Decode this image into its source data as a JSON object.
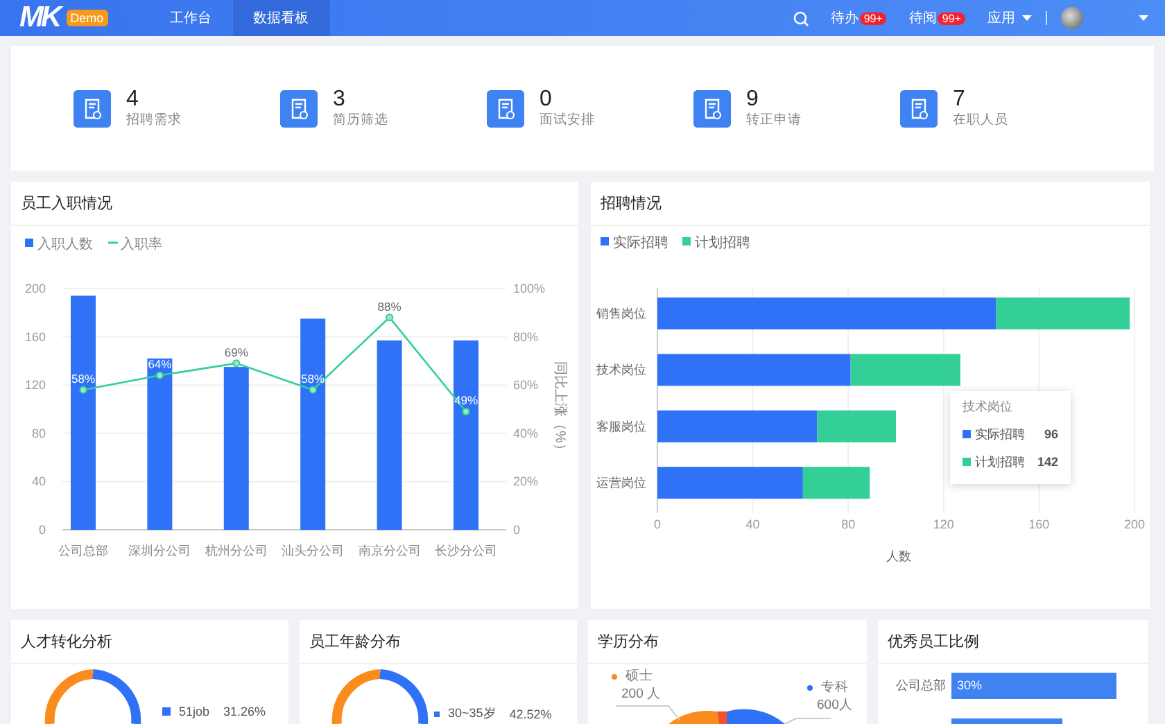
{
  "header": {
    "logo": "MK",
    "badge": "Demo",
    "nav": [
      {
        "label": "工作台",
        "selected": false
      },
      {
        "label": "数据看板",
        "selected": true
      }
    ],
    "notices": [
      {
        "label": "待办",
        "badge": "99+"
      },
      {
        "label": "待阅",
        "badge": "99+"
      }
    ],
    "apps": "应用"
  },
  "stats": [
    {
      "value": "4",
      "label": "招聘需求"
    },
    {
      "value": "3",
      "label": "简历筛选"
    },
    {
      "value": "0",
      "label": "面试安排"
    },
    {
      "value": "9",
      "label": "转正申请"
    },
    {
      "value": "7",
      "label": "在职人员"
    }
  ],
  "onboarding": {
    "title": "员工入职情况",
    "chart_data": {
      "type": "bar",
      "categories": [
        "公司总部",
        "深圳分公司",
        "杭州分公司",
        "汕头分公司",
        "南京分公司",
        "长沙分公司"
      ],
      "legend": true,
      "grid": true,
      "series": [
        {
          "name": "入职人数",
          "type": "bar",
          "color": "#2f72f7",
          "values": [
            194,
            142,
            135,
            175,
            157,
            157
          ]
        },
        {
          "name": "入职率",
          "type": "line",
          "axis": "y2",
          "marker": "circle",
          "color": "#33cf97",
          "values": [
            58,
            64,
            69,
            58,
            88,
            49
          ],
          "value_labels": [
            "58%",
            "64%",
            "69%",
            "58%",
            "88%",
            "49%"
          ]
        }
      ],
      "y2label": "同比上涨（%）",
      "ylim": [
        0,
        200
      ],
      "yticks": [
        0,
        40,
        80,
        120,
        160,
        200
      ],
      "y2lim": [
        0,
        100
      ],
      "y2ticks": [
        {
          "value": 0,
          "label": "0"
        },
        {
          "value": 20,
          "label": "20%"
        },
        {
          "value": 40,
          "label": "40%"
        },
        {
          "value": 60,
          "label": "60%"
        },
        {
          "value": 80,
          "label": "80%"
        },
        {
          "value": 100,
          "label": "100%"
        }
      ]
    }
  },
  "recruitment": {
    "title": "招聘情况",
    "chart_data": {
      "type": "bar",
      "orientation": "horizontal",
      "stacked": true,
      "categories": [
        "销售岗位",
        "技术岗位",
        "客服岗位",
        "运营岗位"
      ],
      "series": [
        {
          "name": "实际招聘",
          "color": "#2f72f7",
          "values": [
            142,
            81,
            67,
            61
          ]
        },
        {
          "name": "计划招聘",
          "color": "#33cf97",
          "values": [
            56,
            46,
            33,
            28
          ]
        }
      ],
      "legend": true,
      "grid": true,
      "xlabel": "人数",
      "xlim": [
        0,
        200
      ],
      "xticks": [
        0,
        40,
        80,
        120,
        160,
        200
      ]
    },
    "tooltip": {
      "title": "技术岗位",
      "items": [
        {
          "label": "实际招聘",
          "value": "96",
          "color": "#2f72f7"
        },
        {
          "label": "计划招聘",
          "value": "142",
          "color": "#33cf97"
        }
      ]
    }
  },
  "conversion": {
    "title": "人才转化分析",
    "legend": [
      {
        "label": "51job",
        "value": "31.26%",
        "color": "#2f72f7"
      }
    ]
  },
  "age": {
    "title": "员工年龄分布",
    "legend": [
      {
        "label": "30~35岁",
        "value": "42.52%",
        "color": "#2f72f7"
      }
    ]
  },
  "education": {
    "title": "学历分布",
    "labels": [
      {
        "label": "硕士",
        "value": "200 人",
        "color": "#fa8c1e"
      },
      {
        "label": "专科",
        "value": "600人",
        "color": "#2f72f7"
      }
    ]
  },
  "excellent": {
    "title": "优秀员工比例",
    "rows": [
      {
        "label": "公司总部",
        "value": "30%"
      }
    ]
  }
}
